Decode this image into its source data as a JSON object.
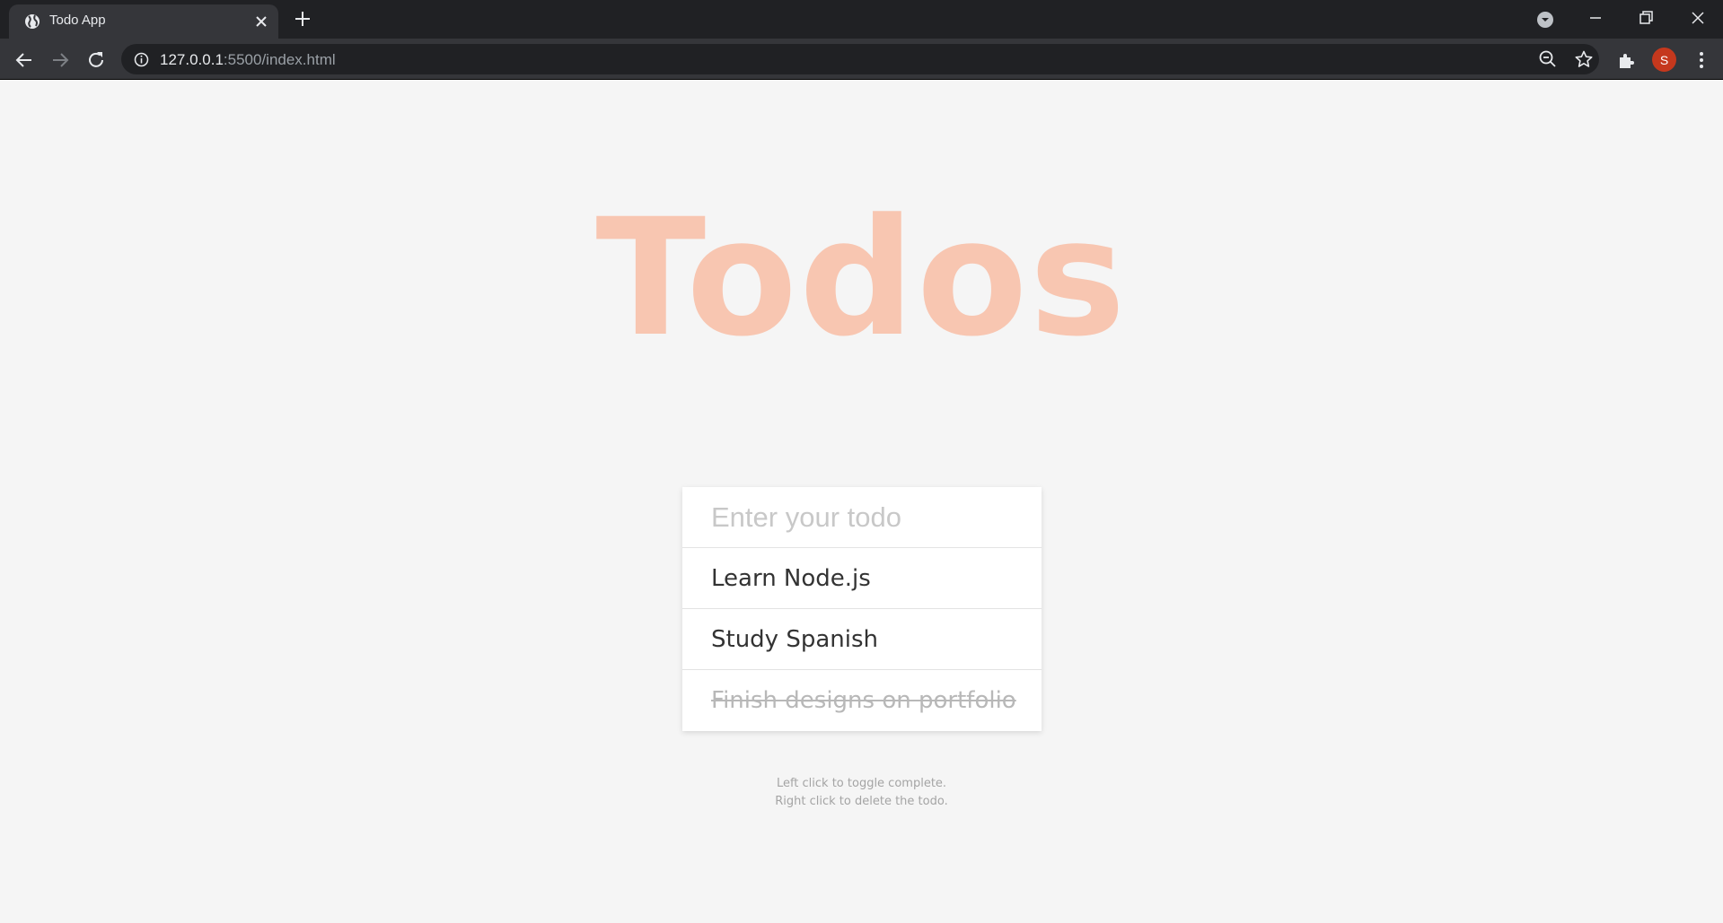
{
  "browser": {
    "tab_title": "Todo App",
    "url_host": "127.0.0.1",
    "url_path": ":5500/index.html",
    "profile_initial": "S",
    "profile_color": "#c5381d"
  },
  "app": {
    "title": "Todos",
    "title_color": "#f8c6b1",
    "input_placeholder": "Enter your todo",
    "todos": [
      {
        "text": "Learn Node.js",
        "completed": false
      },
      {
        "text": "Study Spanish",
        "completed": false
      },
      {
        "text": "Finish designs on portfolio",
        "completed": true
      }
    ],
    "hint_line1": "Left click to toggle complete.",
    "hint_line2": "Right click to delete the todo."
  }
}
